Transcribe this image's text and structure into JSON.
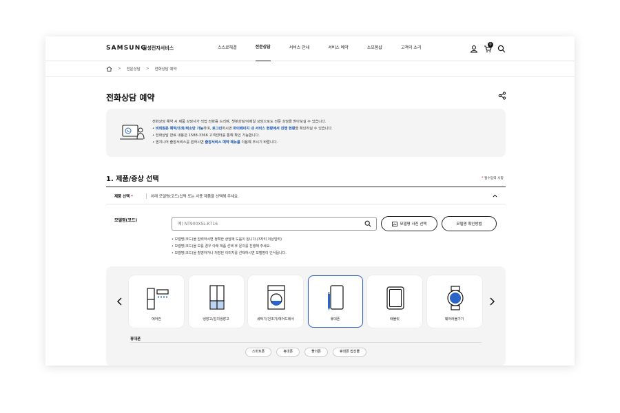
{
  "header": {
    "logo": "SAMSUNG",
    "logo_sub": "삼성전자서비스",
    "nav": [
      "스스로해결",
      "전문상담",
      "서비스 안내",
      "서비스 예약",
      "소모품샵",
      "고객의 소리"
    ],
    "active_nav": "전문상담",
    "cart_count": "0"
  },
  "breadcrumb": [
    "전문상담",
    "전화상담 예약"
  ],
  "page_title": "전화상담 예약",
  "notice": {
    "line1": "전화상담 예약 시 제품 상담사가 직접 전화를 드리며, 챗봇상담/이메일 상담으로도 전문 상담을 받아보실 수 있습니다.",
    "line2_a": "비회원은 예약/조회/취소만 가능",
    "line2_b": "하며, ",
    "line2_c": "로그인",
    "line2_d": "하시면 ",
    "line2_e": "마이페이지 내 서비스 현황에서 진행 현황",
    "line2_f": "을 확인하실 수 있습니다.",
    "line3": "전화상담 완료 내용은 1588-3366 고객센터를 통해 확인 가능합니다.",
    "line4_a": "엔지니어 출장서비스를 원하시면 ",
    "line4_b": "출장서비스 예약 메뉴를",
    "line4_c": " 이용해 주시기 바랍니다."
  },
  "section": {
    "title": "1. 제품/증상 선택",
    "required_note": "필수입력 사항",
    "product_label": "제품 선택",
    "product_desc": "아래 모델명(코드)입력 또는 사용 제품을 선택해 주세요."
  },
  "model": {
    "label": "모델명(코드)",
    "placeholder": "예) NT900X5L-K716",
    "photo_button": "모델명 사진 선택",
    "howto_button": "모델명 확인방법",
    "tips": [
      "모델명(코드)을 입력하시면 정확한 상담에 도움이 됩니다.(3자리 이상입력)",
      "모델명(코드)을 모를 경우 아래 제품 선택 후 문의를 진행해 주세요.",
      "모델명(코드)을 촬영하거나 저장된 이미지를 선택하시면 모델명이 인식됩니다."
    ]
  },
  "products": [
    {
      "label": "에어컨",
      "icon": "air-conditioner-icon"
    },
    {
      "label": "냉장고/김치냉장고",
      "icon": "refrigerator-icon"
    },
    {
      "label": "세탁기/건조기/에어드레서",
      "icon": "washer-icon"
    },
    {
      "label": "휴대폰",
      "icon": "mobile-phone-icon"
    },
    {
      "label": "태블릿",
      "icon": "tablet-icon"
    },
    {
      "label": "웨어러블기기",
      "icon": "wearable-icon"
    }
  ],
  "selected_product": "휴대폰",
  "sub": {
    "title": "휴대폰",
    "chips": [
      "스마트폰",
      "휴대폰",
      "폴더폰",
      "휴대폰 접선물"
    ]
  },
  "colors": {
    "accent_blue": "#1452b0",
    "selected_border": "#2a64c8",
    "required_red": "#e0242b"
  }
}
